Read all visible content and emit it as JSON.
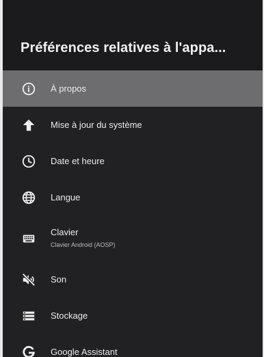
{
  "header": {
    "title": "Préférences relatives à l'appa..."
  },
  "menu": {
    "items": [
      {
        "icon": "info-icon",
        "label": "À propos",
        "selected": true
      },
      {
        "icon": "arrow-up-icon",
        "label": "Mise à jour du système"
      },
      {
        "icon": "clock-icon",
        "label": "Date et heure"
      },
      {
        "icon": "globe-icon",
        "label": "Langue"
      },
      {
        "icon": "keyboard-icon",
        "label": "Clavier",
        "sublabel": "Clavier Android (AOSP)"
      },
      {
        "icon": "sound-off-icon",
        "label": "Son"
      },
      {
        "icon": "storage-icon",
        "label": "Stockage"
      },
      {
        "icon": "google-icon",
        "label": "Google Assistant"
      }
    ]
  },
  "colors": {
    "panel_background": "#212124",
    "header_background": "#1b1b1d",
    "selected_background": "#6d6d6f",
    "text_primary": "#ececec"
  }
}
